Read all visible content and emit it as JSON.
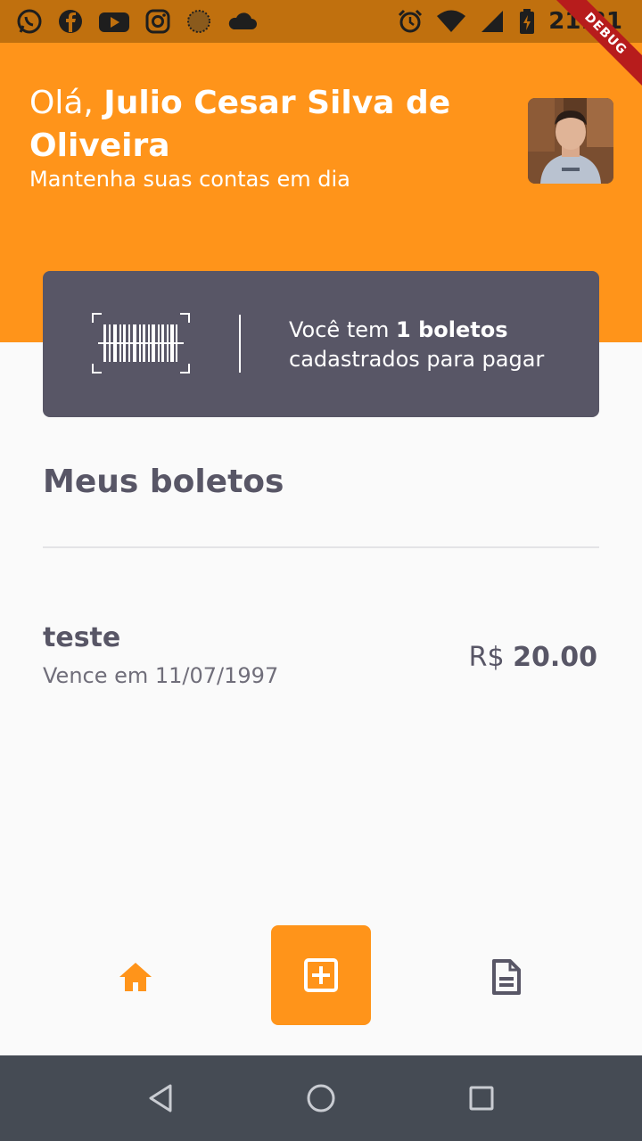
{
  "status_bar": {
    "time": "21:31",
    "left_icons": [
      "whatsapp-icon",
      "facebook-icon",
      "youtube-icon",
      "instagram-icon",
      "sun-icon",
      "cloud-icon"
    ],
    "right_icons": [
      "alarm-icon",
      "wifi-icon",
      "signal-icon",
      "battery-icon"
    ]
  },
  "debug_banner": "DEBUG",
  "header": {
    "greeting_prefix": "Olá, ",
    "user_name": "Julio Cesar Silva de Oliveira",
    "subtitle": "Mantenha suas contas em dia"
  },
  "info_card": {
    "text_prefix": "Você tem ",
    "count_text": "1 boletos",
    "text_suffix": "cadastrados para pagar"
  },
  "section": {
    "title": "Meus boletos"
  },
  "boletos": [
    {
      "name": "teste",
      "due_text": "Vence em 11/07/1997",
      "currency": "R$",
      "value": "20.00"
    }
  ],
  "bottom_nav": {
    "items": [
      "home-icon",
      "add-boleto-icon",
      "documents-icon"
    ]
  },
  "colors": {
    "primary": "#ff941a",
    "heading": "#585666",
    "card": "#585666",
    "status_bar": "#c0700e",
    "system_nav": "#454b54"
  }
}
